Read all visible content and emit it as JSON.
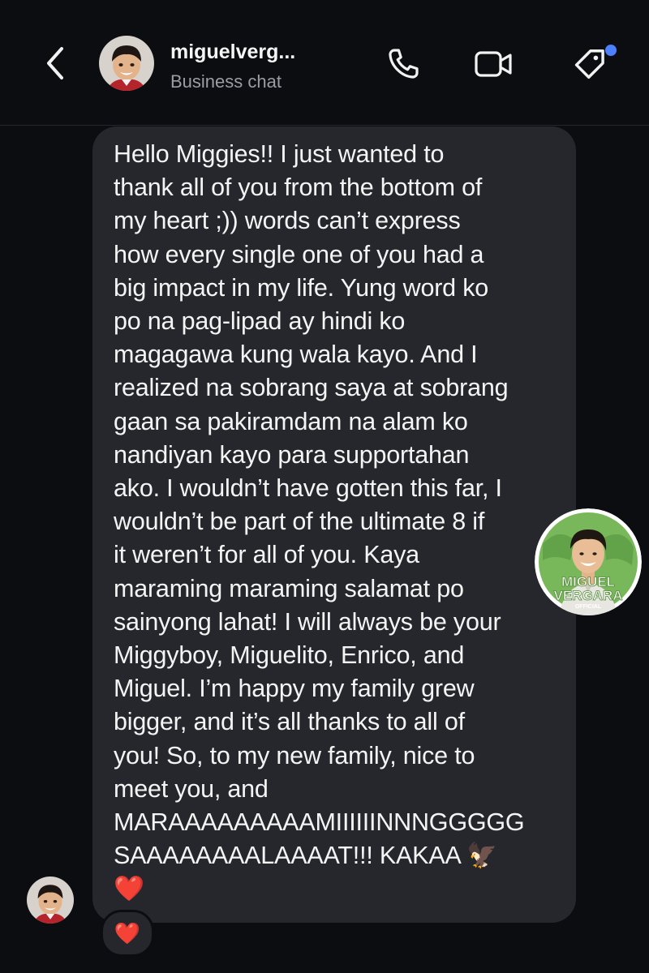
{
  "header": {
    "title": "miguelverg...",
    "subtitle": "Business chat",
    "icons": [
      "back-chevron-icon",
      "phone-icon",
      "video-camera-icon",
      "tag-icon"
    ],
    "notification_dot_color": "#4d80ff"
  },
  "message": {
    "text": "Hello Miggies!! I just wanted to\nthank all of you from the bottom of\nmy heart ;)) words can’t express\nhow every single one of you had a\nbig impact in my life. Yung word ko\npo na pag-lipad ay hindi ko\nmagagawa kung wala kayo. And I\nrealized na sobrang saya at sobrang\ngaan sa pakiramdam na alam ko\nnandiyan kayo para supportahan\nako. I wouldn’t have gotten this far, I\nwouldn’t be part of the ultimate 8 if\nit weren’t for all of you. Kaya\nmaraming maraming salamat po\nsainyong lahat! I will always be your\nMiggyboy, Miguelito, Enrico, and\nMiguel. I’m happy my family grew\nbigger, and it’s all thanks to all of\nyou! So, to my new family, nice to\nmeet you, and\nMARAAAAAAAAAMIIIIIINNNGGGGG\nSAAAAAAAALAAAAT!!! KAKAA 🦅\n❤️",
    "bubble_color": "#25272c"
  },
  "sticker": {
    "line1": "MIGUEL",
    "line2": "VERGARA",
    "line3": "OFFICIAL"
  },
  "reaction": {
    "emoji": "❤️"
  }
}
